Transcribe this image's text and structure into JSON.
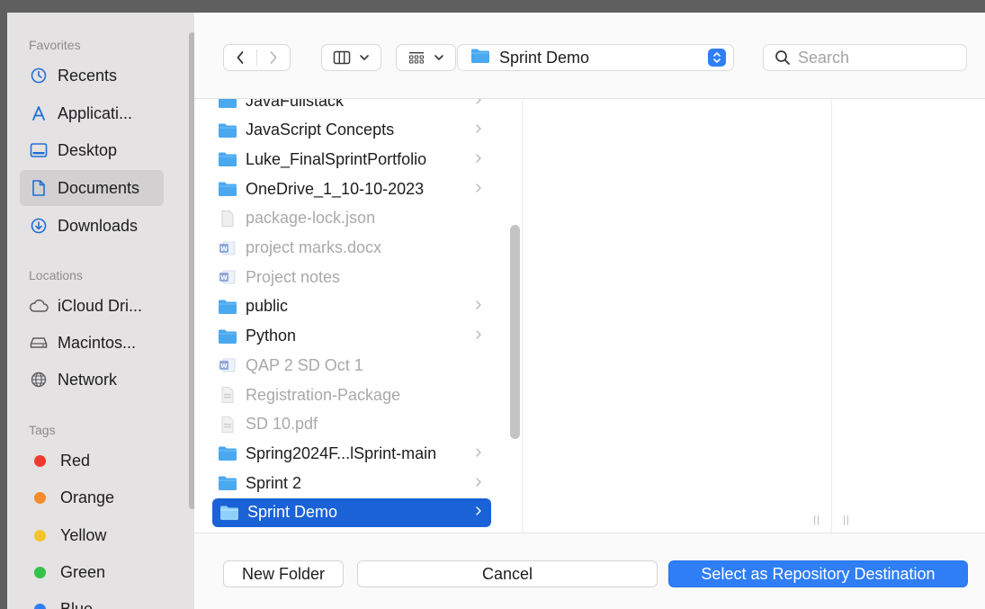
{
  "sidebar": {
    "favorites_label": "Favorites",
    "favorites": [
      {
        "label": "Recents",
        "icon": "clock-icon"
      },
      {
        "label": "Applicati...",
        "icon": "applications-icon"
      },
      {
        "label": "Desktop",
        "icon": "desktop-icon"
      },
      {
        "label": "Documents",
        "icon": "document-icon",
        "selected": true
      },
      {
        "label": "Downloads",
        "icon": "download-icon"
      }
    ],
    "locations_label": "Locations",
    "locations": [
      {
        "label": "iCloud Dri...",
        "icon": "cloud-icon"
      },
      {
        "label": "Macintos...",
        "icon": "hard-drive-icon"
      },
      {
        "label": "Network",
        "icon": "globe-icon"
      }
    ],
    "tags_label": "Tags",
    "tags": [
      {
        "label": "Red",
        "color": "#f03a2f"
      },
      {
        "label": "Orange",
        "color": "#f58b2b"
      },
      {
        "label": "Yellow",
        "color": "#f4c32e"
      },
      {
        "label": "Green",
        "color": "#35c24a"
      },
      {
        "label": "Blue",
        "color": "#2f7ef6"
      }
    ]
  },
  "toolbar": {
    "path_folder": "Sprint Demo",
    "search_placeholder": "Search"
  },
  "files": [
    {
      "name": "JavaFullstack",
      "type": "folder",
      "has_children": true
    },
    {
      "name": "JavaScript Concepts",
      "type": "folder",
      "has_children": true
    },
    {
      "name": "Luke_FinalSprintPortfolio",
      "type": "folder",
      "has_children": true
    },
    {
      "name": "OneDrive_1_10-10-2023",
      "type": "folder",
      "has_children": true
    },
    {
      "name": "package-lock.json",
      "type": "file",
      "dim": true
    },
    {
      "name": "project marks.docx",
      "type": "word",
      "dim": true
    },
    {
      "name": "Project notes",
      "type": "word",
      "dim": true
    },
    {
      "name": "public",
      "type": "folder",
      "has_children": true
    },
    {
      "name": "Python",
      "type": "folder",
      "has_children": true
    },
    {
      "name": "QAP 2 SD Oct 1",
      "type": "word",
      "dim": true
    },
    {
      "name": "Registration-Package",
      "type": "doc",
      "dim": true
    },
    {
      "name": "SD 10.pdf",
      "type": "doc",
      "dim": true
    },
    {
      "name": "Spring2024F...lSprint-main",
      "type": "folder",
      "has_children": true
    },
    {
      "name": "Sprint 2",
      "type": "folder",
      "has_children": true
    },
    {
      "name": "Sprint Demo",
      "type": "folder",
      "has_children": true,
      "selected": true
    }
  ],
  "buttons": {
    "new_folder": "New Folder",
    "cancel": "Cancel",
    "confirm": "Select as Repository Destination"
  },
  "colors": {
    "accent": "#2f7ef6",
    "selection": "#1a62d6",
    "folder": "#4aa8ee"
  }
}
